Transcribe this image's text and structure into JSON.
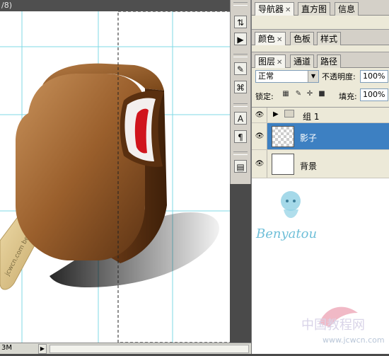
{
  "document": {
    "title_fragment": "/8)",
    "zoom_label": "3M"
  },
  "toolbar_icons": [
    "tool-presets-icon",
    "actions-icon",
    "brushes-icon",
    "clone-source-icon",
    "character-icon",
    "paragraph-icon",
    "layer-comps-icon"
  ],
  "panels": {
    "navigator_group": {
      "tabs": [
        "导航器",
        "直方图",
        "信息"
      ],
      "active": 0
    },
    "color_group": {
      "tabs": [
        "颜色",
        "色板",
        "样式"
      ],
      "active": 0
    },
    "layers_group": {
      "tabs": [
        "图层",
        "通道",
        "路径"
      ],
      "active": 0
    }
  },
  "layers_panel": {
    "blend_mode": "正常",
    "opacity_label": "不透明度:",
    "opacity_value": "100%",
    "lock_label": "锁定:",
    "fill_label": "填充:",
    "fill_value": "100%",
    "layers": [
      {
        "name": "组 1",
        "type": "group",
        "visible": true,
        "selected": false
      },
      {
        "name": "影子",
        "type": "layer",
        "visible": true,
        "selected": true
      },
      {
        "name": "背景",
        "type": "background",
        "visible": true,
        "selected": false
      }
    ]
  },
  "watermarks": {
    "author": "Benyatou",
    "site_cn": "中国教程网",
    "site_url": "www.jcwcn.com",
    "stick_text": "jcwcn.com  benyatou"
  },
  "colors": {
    "selection": "#3d80c2",
    "guide": "#7fd9e6",
    "chocolate": "#8a5120"
  }
}
